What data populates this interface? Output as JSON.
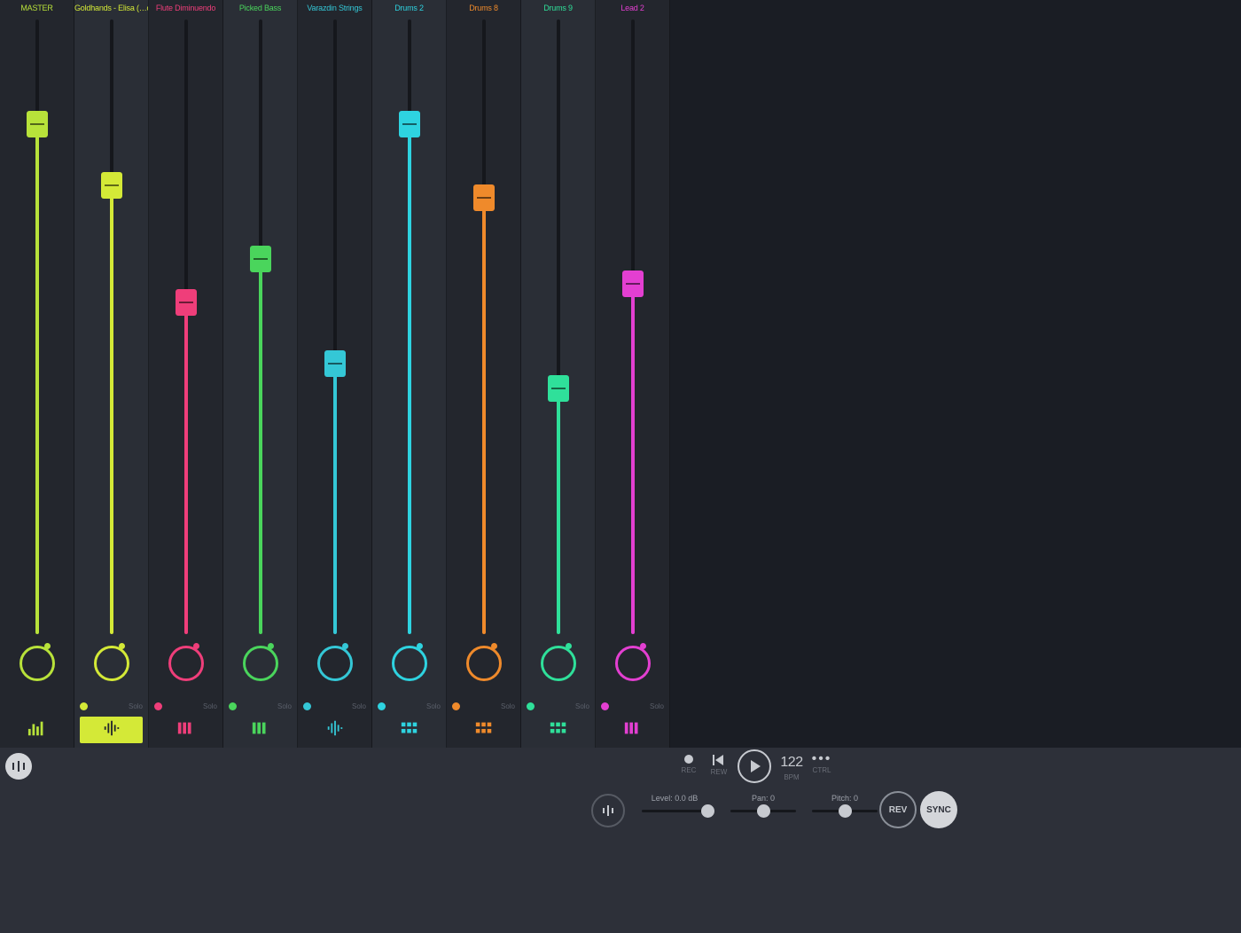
{
  "solo_label": "Solo",
  "channels": [
    {
      "name": "MASTER",
      "color": "#b8e23a",
      "fader_pct": 83,
      "is_master": true,
      "selected": false,
      "icon": "eq-bars"
    },
    {
      "name": "Goldhands - Elisa (…ocal)",
      "color": "#d4e937",
      "fader_pct": 73,
      "is_master": false,
      "selected": true,
      "icon": "waveform"
    },
    {
      "name": "Flute Diminuendo",
      "color": "#ef3e7a",
      "fader_pct": 54,
      "is_master": false,
      "selected": false,
      "icon": "piano"
    },
    {
      "name": "Picked Bass",
      "color": "#4ad55c",
      "fader_pct": 61,
      "is_master": false,
      "selected": false,
      "icon": "piano"
    },
    {
      "name": "Varazdin Strings",
      "color": "#34c7d6",
      "fader_pct": 44,
      "is_master": false,
      "selected": false,
      "icon": "waveform"
    },
    {
      "name": "Drums 2",
      "color": "#2ed3e0",
      "fader_pct": 83,
      "is_master": false,
      "selected": false,
      "icon": "pads"
    },
    {
      "name": "Drums 8",
      "color": "#ef8a2b",
      "fader_pct": 71,
      "is_master": false,
      "selected": false,
      "icon": "pads"
    },
    {
      "name": "Drums 9",
      "color": "#2fe09a",
      "fader_pct": 40,
      "is_master": false,
      "selected": false,
      "icon": "pads"
    },
    {
      "name": "Lead 2",
      "color": "#e33fd1",
      "fader_pct": 57,
      "is_master": false,
      "selected": false,
      "icon": "piano"
    }
  ],
  "transport": {
    "rec_label": "REC",
    "rew_label": "REW",
    "bpm_value": "122",
    "bpm_label": "BPM",
    "ctrl_label": "CTRL"
  },
  "params": {
    "level": {
      "label": "Level: 0.0 dB"
    },
    "pan": {
      "label": "Pan: 0"
    },
    "pitch": {
      "label": "Pitch: 0"
    }
  },
  "buttons": {
    "rev": "REV",
    "sync": "SYNC"
  }
}
